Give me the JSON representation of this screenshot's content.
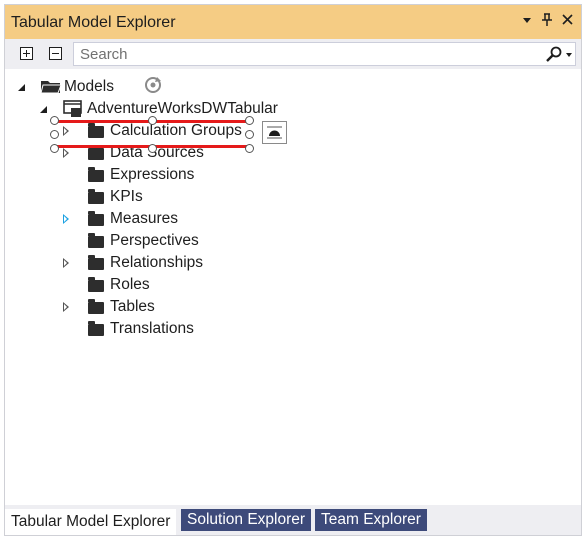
{
  "window": {
    "title": "Tabular Model Explorer",
    "dropdown_icon": "dropdown-arrow-icon",
    "pin_icon": "pin-icon",
    "close_icon": "close-icon"
  },
  "toolbar": {
    "expand_all_icon": "expand-all-icon",
    "collapse_all_icon": "collapse-all-icon",
    "search_placeholder": "Search"
  },
  "tree": {
    "root_label": "Models",
    "model_label": "AdventureWorksDWTabular",
    "items": [
      {
        "label": "Calculation Groups",
        "expandable": true
      },
      {
        "label": "Data Sources",
        "expandable": true
      },
      {
        "label": "Expressions",
        "expandable": false
      },
      {
        "label": "KPIs",
        "expandable": false
      },
      {
        "label": "Measures",
        "expandable": true
      },
      {
        "label": "Perspectives",
        "expandable": false
      },
      {
        "label": "Relationships",
        "expandable": true
      },
      {
        "label": "Roles",
        "expandable": false
      },
      {
        "label": "Tables",
        "expandable": true
      },
      {
        "label": "Translations",
        "expandable": false
      }
    ]
  },
  "tabs": [
    {
      "label": "Tabular Model Explorer",
      "active": true
    },
    {
      "label": "Solution Explorer",
      "active": false
    },
    {
      "label": "Team Explorer",
      "active": false
    }
  ],
  "colors": {
    "titlebar": "#f5cc84",
    "tab_inactive": "#3d4a7a",
    "selection_outline": "#e51a1a"
  }
}
